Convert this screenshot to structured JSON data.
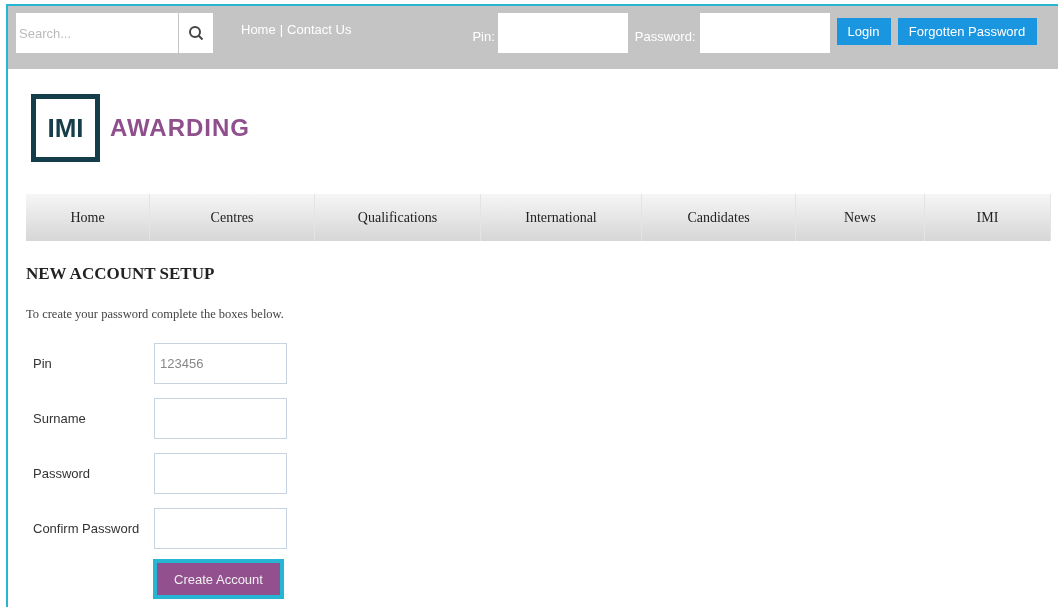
{
  "header": {
    "search": {
      "placeholder": "Search..."
    },
    "links": [
      "Home",
      "Contact Us"
    ],
    "separator": "|",
    "login": {
      "pin_label": "Pin:",
      "password_label": "Password:"
    },
    "buttons": [
      "Login",
      "Forgotten Password"
    ]
  },
  "logo": {
    "mark": "IMI",
    "name": "AWARDING"
  },
  "nav": [
    "Home",
    "Centres",
    "Qualifications",
    "International",
    "Candidates",
    "News",
    "IMI"
  ],
  "page": {
    "title": "NEW ACCOUNT SETUP",
    "intro": "To create your password complete the boxes below.",
    "fields": [
      {
        "label": "Pin",
        "value": "123456"
      },
      {
        "label": "Surname"
      },
      {
        "label": "Password"
      },
      {
        "label": "Confirm Password"
      }
    ],
    "submit": "Create Account"
  }
}
